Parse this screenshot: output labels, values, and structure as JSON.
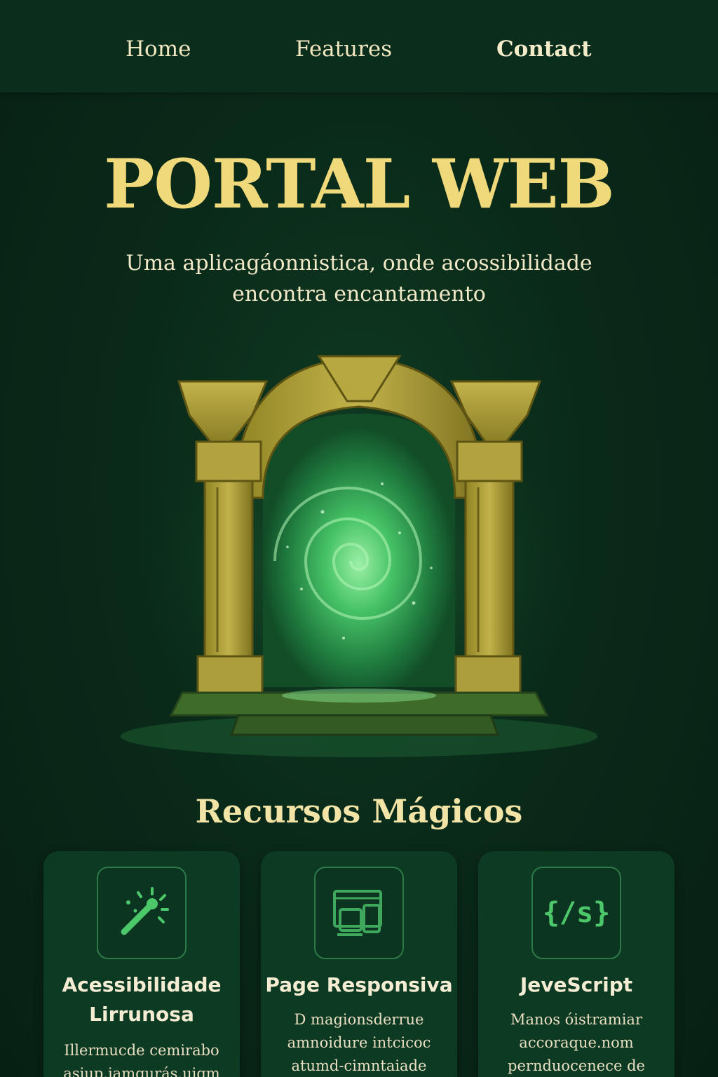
{
  "nav": {
    "home": "Home",
    "features": "Features",
    "contact": "Contact"
  },
  "hero": {
    "title": "PORTAL WEB",
    "subtitle": "Uma aplicagáonnistica, onde acossibilidade encontra encantamento"
  },
  "features": {
    "title": "Recursos Mágicos",
    "cards": [
      {
        "icon": "magic-wand-icon",
        "title": "Acessibilidade Lirrunosa",
        "text": "Illermucde cemirabo asiup.iamqurás.uigm"
      },
      {
        "icon": "responsive-devices-icon",
        "title": "Page Responsiva",
        "text": "D magionsderrue amnoidure intcicoc atumd-cimntaiade"
      },
      {
        "icon": "code-braces-icon",
        "icon_text": "{/s}",
        "title": "JeveScript",
        "text": "Manos óistramiar accoraque.nom pernduocenece de"
      }
    ]
  },
  "colors": {
    "background": "#0a2a19",
    "nav": "#0b2e1c",
    "gold": "#f0d97a",
    "card": "#0d3a22",
    "accent_green": "#4cc86a"
  }
}
